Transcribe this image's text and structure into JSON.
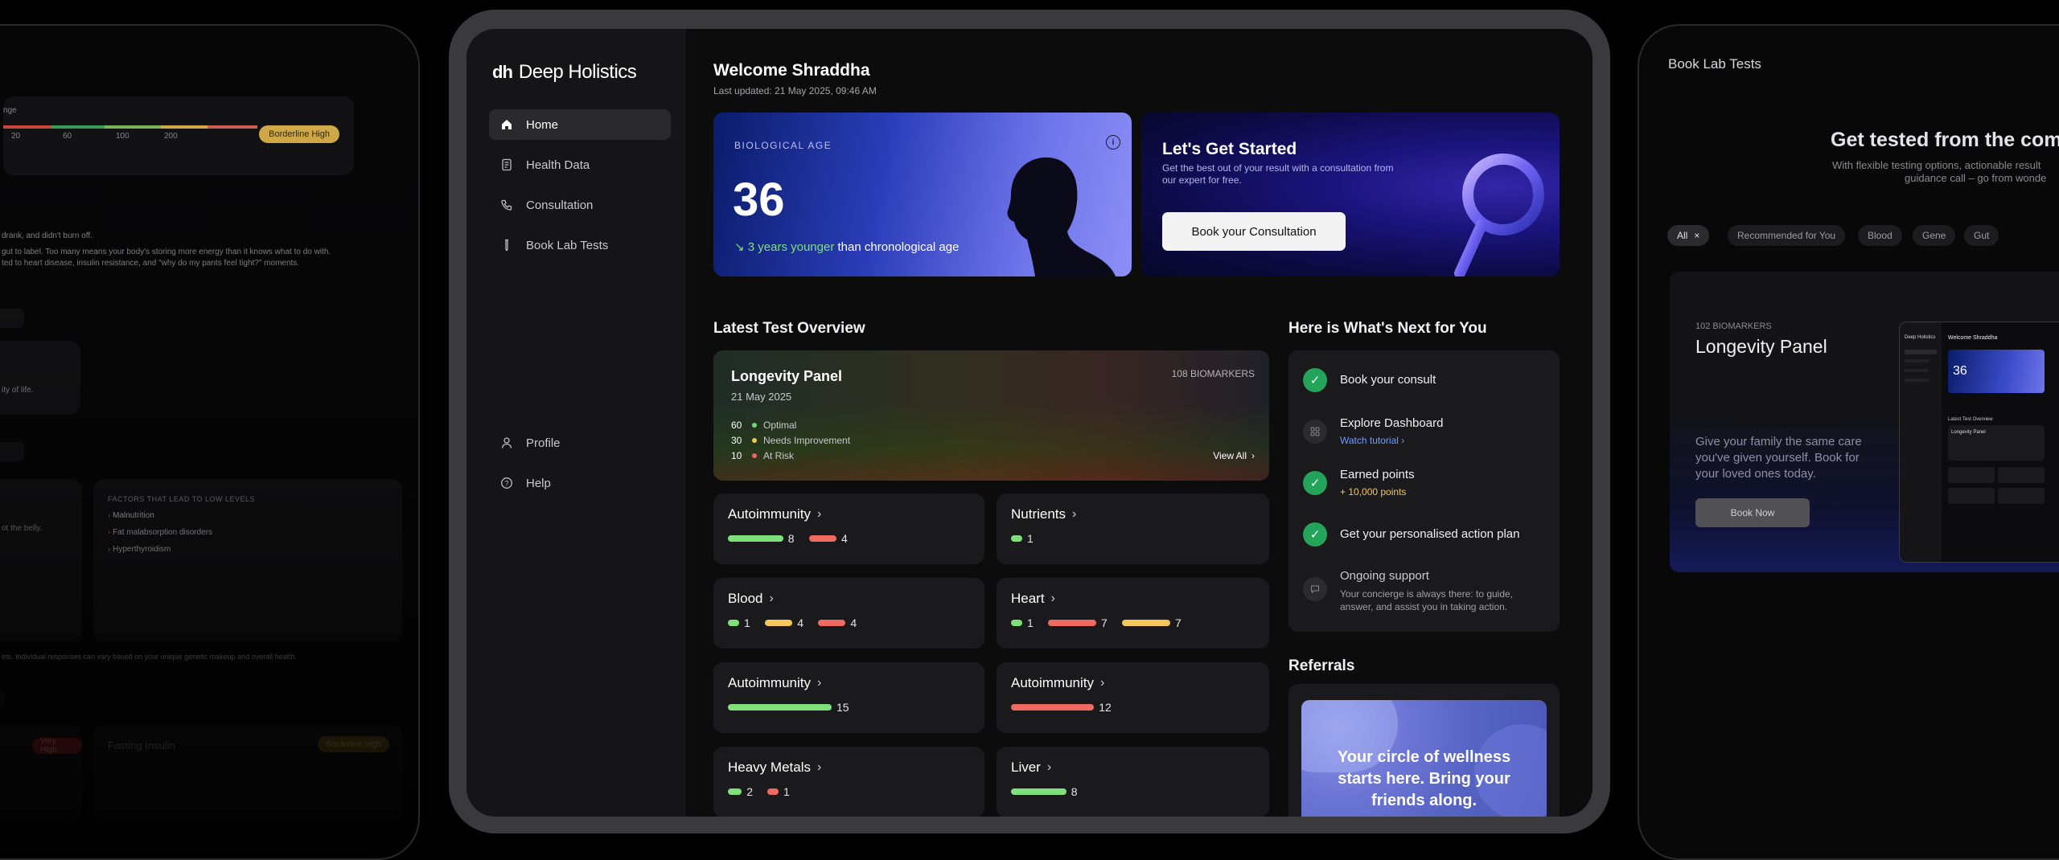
{
  "left_panel": {
    "range_label": "nge",
    "scale_ticks": [
      "20",
      "60",
      "100",
      "200"
    ],
    "status_badge": "Borderline High",
    "intro_line": "drank, and didn't burn off.",
    "desc_line1": "gut to label. Too many means your body's storing more energy than it knows what to do with.",
    "desc_line2": "ted to heart disease, insulin resistance, and \"why do my pants feel tight?\" moments.",
    "quality_text": "ity of life.",
    "belly_text": "ot the belly.",
    "factors_title": "FACTORS THAT LEAD TO LOW LEVELS",
    "factors": [
      "Malnutrition",
      "Fat malabsorption disorders",
      "Hyperthyroidism"
    ],
    "disclaimer": "ets. Individual responses can vary based on your unique genetic makeup and overall health.",
    "bottom_badge_left": "Very High",
    "bottom_card_title": "Fasting Insulin",
    "bottom_badge_right": "Borderline High"
  },
  "sidebar": {
    "logo": "dh",
    "brand": "Deep Holistics",
    "nav": [
      {
        "label": "Home",
        "icon": "home-icon"
      },
      {
        "label": "Health Data",
        "icon": "document-icon"
      },
      {
        "label": "Consultation",
        "icon": "phone-icon"
      },
      {
        "label": "Book Lab Tests",
        "icon": "test-tube-icon"
      }
    ],
    "bottom_nav": [
      {
        "label": "Profile",
        "icon": "person-icon"
      },
      {
        "label": "Help",
        "icon": "help-icon"
      }
    ]
  },
  "header": {
    "title": "Welcome Shraddha",
    "updated": "Last updated: 21 May 2025, 09:46 AM"
  },
  "bio_age": {
    "label": "BIOLOGICAL AGE",
    "value": "36",
    "delta": "3 years younger",
    "delta_suffix": "than chronological age"
  },
  "get_started": {
    "title": "Let's Get Started",
    "desc": "Get the best out of your result with a consultation from our expert for free.",
    "button": "Book your Consultation"
  },
  "overview": {
    "heading": "Latest Test Overview",
    "panel_title": "Longevity Panel",
    "panel_date": "21 May 2025",
    "biomarkers": "108 BIOMARKERS",
    "legend": [
      {
        "count": "60",
        "label": "Optimal",
        "color": "#6fdc7a"
      },
      {
        "count": "30",
        "label": "Needs Improvement",
        "color": "#f1c64e"
      },
      {
        "count": "10",
        "label": "At Risk",
        "color": "#ee6a5f"
      }
    ],
    "view_all": "View All",
    "categories": [
      {
        "name": "Autoimmunity",
        "bars": [
          {
            "n": "8",
            "color": "#7ee07a",
            "v": 8
          },
          {
            "n": "4",
            "color": "#ef6b61",
            "v": 4
          }
        ]
      },
      {
        "name": "Nutrients",
        "bars": [
          {
            "n": "1",
            "color": "#7ee07a",
            "v": 1
          }
        ]
      },
      {
        "name": "Blood",
        "bars": [
          {
            "n": "1",
            "color": "#7ee07a",
            "v": 1
          },
          {
            "n": "4",
            "color": "#f3c75a",
            "v": 4
          },
          {
            "n": "4",
            "color": "#ef6b61",
            "v": 4
          }
        ]
      },
      {
        "name": "Heart",
        "bars": [
          {
            "n": "1",
            "color": "#7ee07a",
            "v": 1
          },
          {
            "n": "7",
            "color": "#ef6b61",
            "v": 7
          },
          {
            "n": "7",
            "color": "#f3c75a",
            "v": 7
          }
        ]
      },
      {
        "name": "Autoimmunity",
        "bars": [
          {
            "n": "15",
            "color": "#7ee07a",
            "v": 15
          }
        ]
      },
      {
        "name": "Autoimmunity",
        "bars": [
          {
            "n": "12",
            "color": "#ef6b61",
            "v": 12
          }
        ]
      },
      {
        "name": "Heavy Metals",
        "bars": [
          {
            "n": "2",
            "color": "#7ee07a",
            "v": 2
          },
          {
            "n": "1",
            "color": "#ef6b61",
            "v": 1
          }
        ]
      },
      {
        "name": "Liver",
        "bars": [
          {
            "n": "8",
            "color": "#7ee07a",
            "v": 8
          }
        ]
      }
    ]
  },
  "next": {
    "heading": "Here is What's Next for You",
    "steps": [
      {
        "title": "Book your consult",
        "sub": "",
        "done": true
      },
      {
        "title": "Explore Dashboard",
        "sub": "Watch tutorial",
        "done": false
      },
      {
        "title": "Earned points",
        "sub": "+ 10,000 points",
        "done": true
      },
      {
        "title": "Get your personalised action plan",
        "sub": "",
        "done": true
      },
      {
        "title": "Ongoing support",
        "sub": "Your concierge is always there: to guide, answer, and assist you in taking action.",
        "done": false
      }
    ]
  },
  "referrals": {
    "heading": "Referrals",
    "text": "Your circle of wellness starts here. Bring your friends along."
  },
  "right_panel": {
    "title": "Book Lab Tests",
    "hero": "Get tested from the comfo",
    "hero_sub1": "With flexible testing options, actionable result",
    "hero_sub2": "guidance call – go from wonde",
    "filters": [
      "All",
      "Recommended for You",
      "Blood",
      "Gene",
      "Gut"
    ],
    "card_tag": "102 BIOMARKERS",
    "card_title": "Longevity Panel",
    "card_desc": "Give your family the same care you've given yourself. Book for your loved ones today.",
    "card_button": "Book Now",
    "mini_brand": "Deep Holistics",
    "mini_welcome": "Welcome Shraddha",
    "mini_age": "36",
    "mini_overview": "Latest Test Overview",
    "mini_panel": "Longevity Panel"
  }
}
